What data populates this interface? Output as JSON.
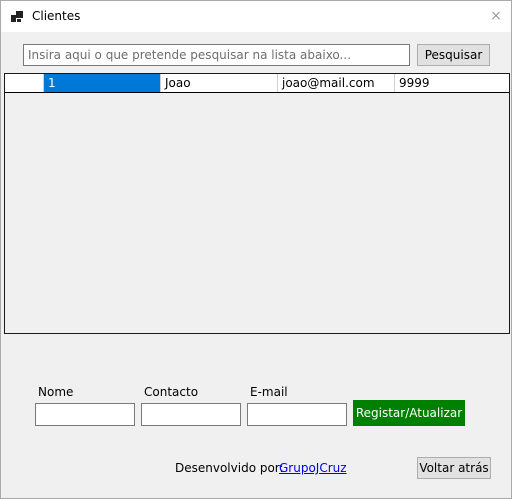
{
  "window": {
    "title": "Clientes",
    "close_glyph": "×",
    "app_icon": "form-icon"
  },
  "search": {
    "placeholder": "Insira aqui o que pretende pesquisar na lista abaixo...",
    "button_label": "Pesquisar"
  },
  "grid": {
    "rows": [
      {
        "id": "1",
        "nome": "Joao",
        "email": "joao@mail.com",
        "contacto": "9999",
        "selected_cell": "id"
      }
    ]
  },
  "form": {
    "nome_label": "Nome",
    "contacto_label": "Contacto",
    "email_label": "E-mail",
    "nome_value": "",
    "contacto_value": "",
    "email_value": "",
    "submit_label": "Registar/Atualizar",
    "submit_color": "#008000"
  },
  "footer": {
    "credit_label": "Desenvolvido por:",
    "credit_link": "GrupoJCruz",
    "back_label": "Voltar atrás"
  },
  "colors": {
    "selection": "#0078d7",
    "background": "#f0f0f0"
  }
}
